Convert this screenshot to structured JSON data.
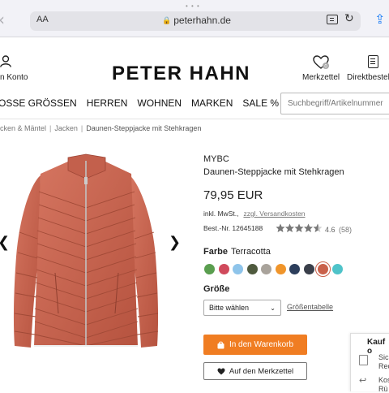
{
  "browser": {
    "text_size_label": "AA",
    "url": "peterhahn.de"
  },
  "header": {
    "account_label": "n Konto",
    "logo": "PETER HAHN",
    "wishlist_label": "Merkzettel",
    "wishlist_count": "0",
    "quick_order_label": "Direktbestell"
  },
  "nav": {
    "items": [
      "OSSE GRÖSSEN",
      "HERREN",
      "WOHNEN",
      "MARKEN",
      "SALE %"
    ],
    "search_placeholder": "Suchbegriff/Artikelnummer"
  },
  "breadcrumb": {
    "items": [
      "cken & Mäntel",
      "Jacken",
      "Daunen-Steppjacke mit Stehkragen"
    ],
    "separator": "|"
  },
  "product": {
    "brand": "MYBC",
    "name": "Daunen-Steppjacke mit Stehkragen",
    "price": "79,95 EUR",
    "tax": "inkl. MwSt.,",
    "shipping_link": "zzgl. Versandkosten",
    "article_no": "Best.-Nr. 12645188",
    "rating": "4.6",
    "rating_value": 4.6,
    "rating_max": 5,
    "rating_count": "(58)",
    "color_label": "Farbe",
    "color_value": "Terracotta",
    "swatches": [
      "#5a9e4f",
      "#d04a5c",
      "#8ec4ea",
      "#4f5a3e",
      "#a9a39b",
      "#f0952b",
      "#2c3e5c",
      "#3a3f4a",
      "#c9604a",
      "#4fc3c9"
    ],
    "selected_swatch": 8,
    "size_label": "Größe",
    "size_select": "Bitte wählen",
    "size_table_link": "Größentabelle",
    "cart_button": "In den Warenkorb",
    "wishlist_button": "Auf den Merkzettel",
    "accent_color": "#f07d22",
    "jacket_color": "#c9604a"
  },
  "side_panel": {
    "title": "Kauf o",
    "item1_line1": "Sich",
    "item1_line2": "Rec",
    "item2_line1": "Kos",
    "item2_line2": "Rü"
  }
}
